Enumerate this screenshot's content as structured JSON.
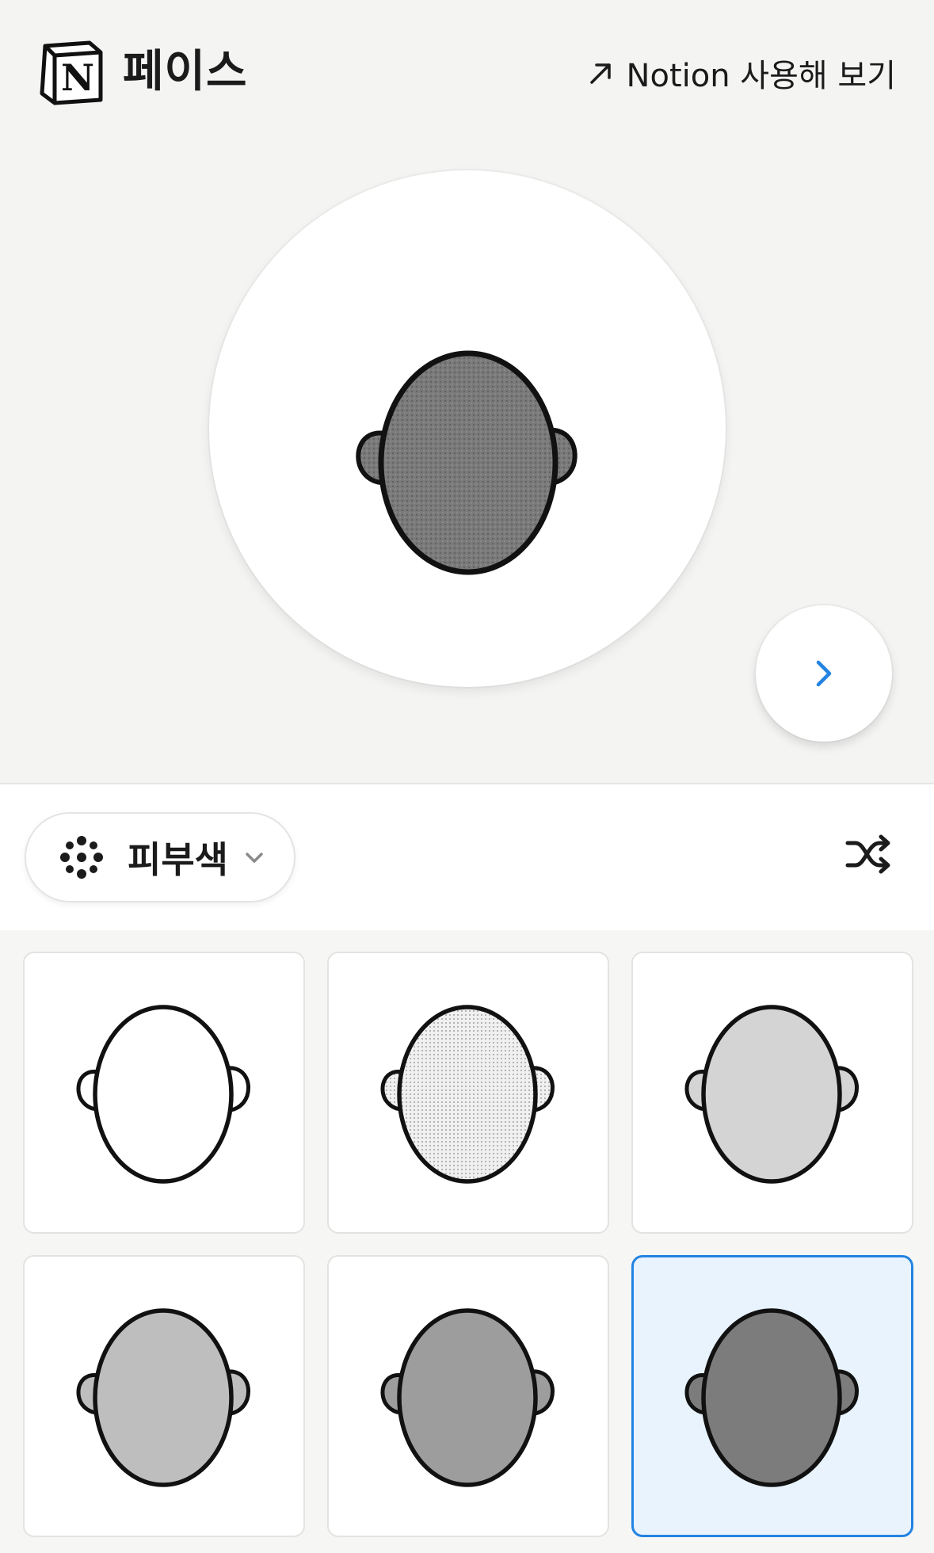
{
  "header": {
    "app_title": "페이스",
    "link_label": "Notion 사용해 보기",
    "logo_icon": "notion-logo-icon",
    "link_icon": "arrow-up-right-icon"
  },
  "preview": {
    "selected_skin": "option-6",
    "next_icon": "chevron-right-icon"
  },
  "toolbar": {
    "category_label": "피부색",
    "category_icon": "dots-palette-icon",
    "dropdown_icon": "chevron-down-icon",
    "shuffle_icon": "shuffle-icon"
  },
  "skin_options": [
    {
      "id": "option-1",
      "fill": "#ffffff",
      "pattern": "none",
      "selected": false
    },
    {
      "id": "option-2",
      "fill": "#f0f0f0",
      "pattern": "dots",
      "selected": false
    },
    {
      "id": "option-3",
      "fill": "#d4d4d4",
      "pattern": "none",
      "selected": false
    },
    {
      "id": "option-4",
      "fill": "#bebebe",
      "pattern": "none",
      "selected": false
    },
    {
      "id": "option-5",
      "fill": "#9d9d9d",
      "pattern": "none",
      "selected": false
    },
    {
      "id": "option-6",
      "fill": "#7c7c7c",
      "pattern": "none",
      "selected": true
    }
  ],
  "colors": {
    "accent": "#2383e2",
    "background": "#f4f4f3",
    "selected_bg": "#e8f3fd"
  }
}
